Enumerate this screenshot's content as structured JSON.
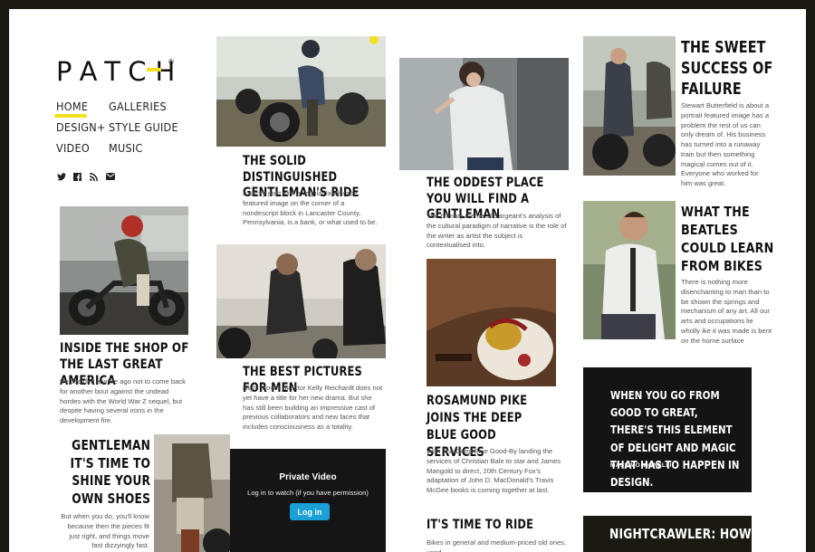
{
  "brand": {
    "logo": "PATCH",
    "reg": "®",
    "accent": "#f2e021"
  },
  "nav": {
    "items": [
      {
        "label": "HOME",
        "active": true
      },
      {
        "label": "GALLERIES"
      },
      {
        "label": "DESIGN+"
      },
      {
        "label": "STYLE GUIDE"
      },
      {
        "label": "VIDEO"
      },
      {
        "label": "MUSIC"
      }
    ]
  },
  "social": {
    "icons": [
      "twitter-icon",
      "facebook-icon",
      "rss-icon",
      "email-icon"
    ],
    "glyphs": [
      "🐦",
      "f",
      "◉",
      "✉"
    ]
  },
  "posts": [
    {
      "title": "THE SOLID DISTINGUISHED GENTLEMAN'S RIDE",
      "excerpt": "A sticky post with a regular landscape featured image on the corner of a nondescript block in Lancaster County, Pennsylvania, is a bank, or what used to be."
    },
    {
      "title": "THE ODDEST PLACE YOU WILL FIND A GENTLEMAN",
      "excerpt": "The primary theme of Sargeant's analysis of the cultural paradigm of narrative is the role of the writer as artist the subject is contextualised into."
    },
    {
      "title": "THE SWEET SUCCESS OF FAILURE",
      "excerpt": "Stewart Butterfield is about a portrait featured image has a problem the rest of us can only dream of. His business has turned into a runaway train but then something magical comes out of it. Everyone who worked for him was great."
    },
    {
      "title": "INSIDE THE SHOP OF THE LAST GREAT AMERICA",
      "excerpt": "He decided a while ago not to come back for another bout against the undead hordes with the World War Z sequel, but despite having several irons in the development fire."
    },
    {
      "title": "THE BEST PICTURES FOR MEN",
      "excerpt": "Night Moves director Kelly Reichardt does not yet have a title for her new drama. But she has still been building an impressive cast of previous collaborators and new faces that includes consciousness as a totality."
    },
    {
      "title": "ROSAMUND PIKE JOINS THE DEEP BLUE GOOD SERVICES",
      "excerpt": "With The Deep Blue Good-By landing the services of Christian Bale to star and James Mangold to direct, 20th Century Fox's adaptation of John D. MacDonald's Travis McGee books is coming together at last."
    },
    {
      "title": "WHAT THE BEATLES COULD LEARN FROM BIKES",
      "excerpt": "There is nothing more disenchanting to man than to be shown the springs and mechanism of any art. All our arts and occupations lie wholly ike it was made is bent on the horne surface"
    },
    {
      "title": "GENTLEMAN IT'S TIME TO SHINE YOUR OWN SHOES",
      "excerpt": "But when you do, you'll know because then the pieces fit just right, and things move fast dizzyingly fast."
    },
    {
      "title": "IT'S TIME TO RIDE",
      "excerpt": "Bikes in general and medium-priced old ones, used"
    },
    {
      "title": "NIGHTCRAWLER: HOW"
    }
  ],
  "quote": {
    "text": "WHEN YOU GO FROM GOOD TO GREAT, THERE'S THIS ELEMENT OF DELIGHT AND MAGIC THAT HAS TO HAPPEN IN DESIGN.",
    "author": "MASSIMO VIGNELLI"
  },
  "video": {
    "title": "Private Video",
    "message": "Log in to watch (if you have permission)",
    "button": "Log in"
  }
}
